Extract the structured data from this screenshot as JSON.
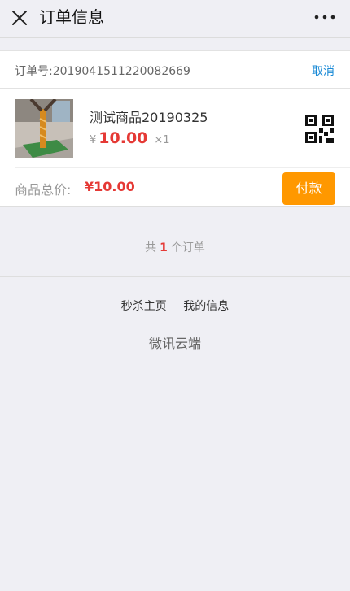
{
  "header": {
    "title": "订单信息",
    "close_icon": "close-icon",
    "more_icon": "more-dots-icon"
  },
  "order": {
    "number_label": "订单号:",
    "number": "2019041511220082669",
    "cancel_label": "取消",
    "product": {
      "name": "测试商品20190325",
      "currency_symbol": "¥",
      "price": "10.00",
      "quantity": "×1",
      "qr_icon": "qr-code-icon"
    },
    "total_label": "商品总价:",
    "total_value": "¥10.00",
    "pay_label": "付款"
  },
  "summary": {
    "prefix": "共",
    "count": "1",
    "suffix": "个订单"
  },
  "footer": {
    "links": [
      "秒杀主页",
      "我的信息"
    ],
    "brand": "微讯云端"
  },
  "colors": {
    "accent_price": "#e53935",
    "pay_button": "#ff9800",
    "link": "#1a8ad6"
  }
}
